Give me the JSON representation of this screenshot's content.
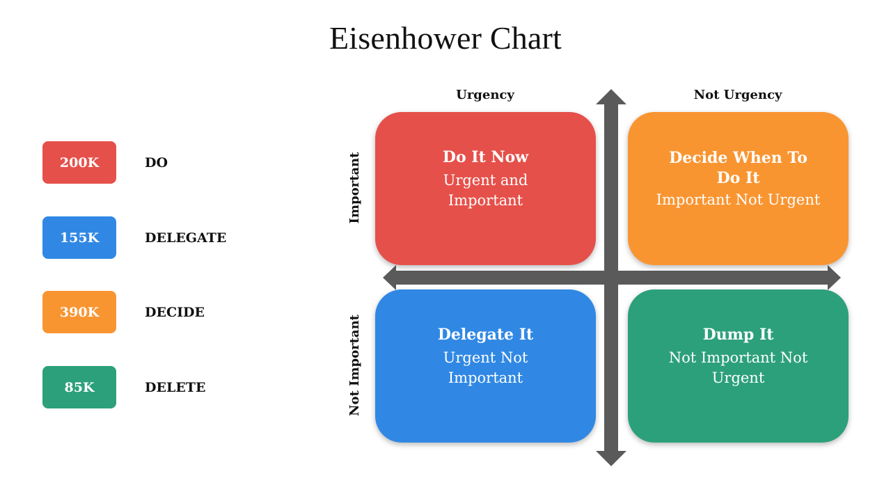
{
  "title": "Eisenhower Chart",
  "colors": {
    "do": "#E6504A",
    "delegate": "#3088E4",
    "decide": "#F99531",
    "delete": "#2CA07A",
    "arrow": "#5A5A5A"
  },
  "legend": [
    {
      "value": "200K",
      "label": "DO",
      "color": "#E6504A"
    },
    {
      "value": "155K",
      "label": "DELEGATE",
      "color": "#3088E4"
    },
    {
      "value": "390K",
      "label": "DECIDE",
      "color": "#F99531"
    },
    {
      "value": "85K",
      "label": "DELETE",
      "color": "#2CA07A"
    }
  ],
  "axes": {
    "columns": [
      "Urgency",
      "Not Urgency"
    ],
    "rows": [
      "Important",
      "Not Important"
    ]
  },
  "quadrants": [
    {
      "title": "Do It Now",
      "subtitle": "Urgent and Important",
      "color": "#E6504A"
    },
    {
      "title": "Decide When To Do It",
      "subtitle": "Important Not Urgent",
      "color": "#F99531"
    },
    {
      "title": "Delegate It",
      "subtitle": "Urgent Not Important",
      "color": "#3088E4"
    },
    {
      "title": "Dump It",
      "subtitle": "Not Important Not Urgent",
      "color": "#2CA07A"
    }
  ]
}
